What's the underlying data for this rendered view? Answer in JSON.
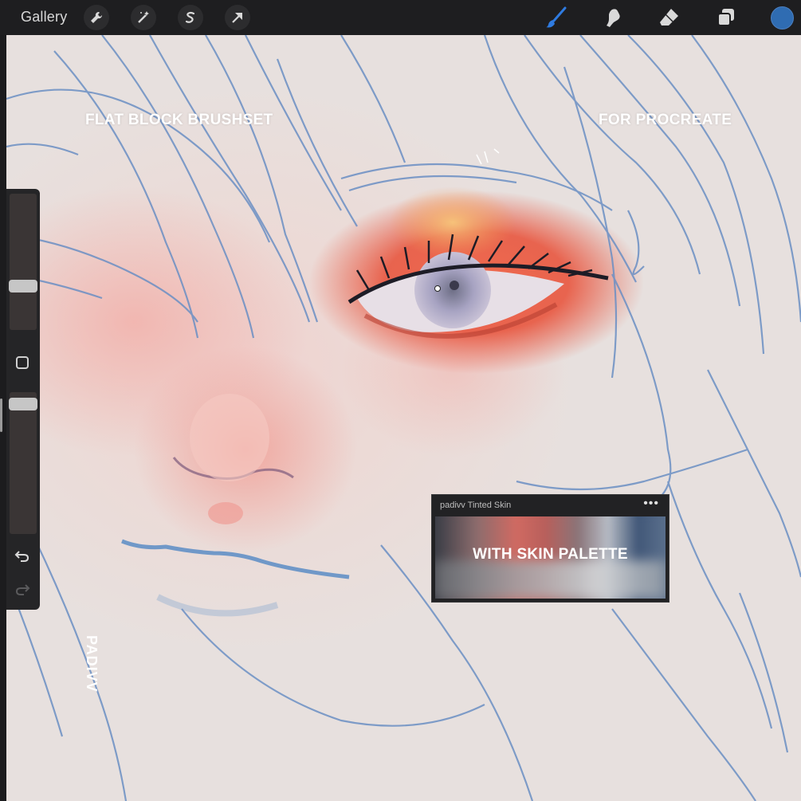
{
  "topbar": {
    "gallery_label": "Gallery",
    "left_tools": [
      {
        "name": "wrench-icon"
      },
      {
        "name": "magic-wand-icon"
      },
      {
        "name": "selection-s-icon"
      },
      {
        "name": "transform-arrow-icon"
      }
    ],
    "right_tools": [
      {
        "name": "brush-icon",
        "active": true
      },
      {
        "name": "smudge-icon"
      },
      {
        "name": "eraser-icon"
      },
      {
        "name": "layers-icon"
      }
    ],
    "active_color": "#2f6cb2"
  },
  "sidebar": {
    "brush_size_level": 0.5,
    "opacity_level": 0.95,
    "undo_icon": "undo-icon",
    "redo_icon": "redo-icon"
  },
  "overlay": {
    "title_left": "FLAT BLOCK BRUSHSET",
    "title_right": "FOR PROCREATE",
    "vertical_text": "PADIVV",
    "palette_caption": "WITH SKIN PALETTE"
  },
  "palette": {
    "name": "padivv Tinted Skin",
    "menu": "•••"
  },
  "colors": {
    "sketch_blue": "#6b8fc4",
    "eyeshadow": "#e0523f",
    "skin": "#efd2cf"
  }
}
